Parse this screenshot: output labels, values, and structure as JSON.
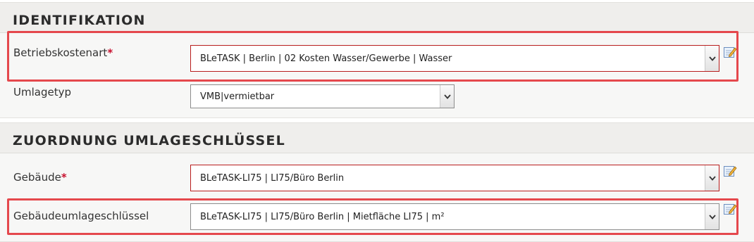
{
  "identifikation": {
    "title": "IDENTIFIKATION",
    "betriebskostenart": {
      "label": "Betriebskostenart",
      "required_mark": "*",
      "value": "BLeTASK | Berlin | 02 Kosten Wasser/Gewerbe | Wasser"
    },
    "umlagetyp": {
      "label": "Umlagetyp",
      "value": "VMB|vermietbar"
    }
  },
  "zuordnung": {
    "title": "ZUORDNUNG UMLAGESCHLÜSSEL",
    "gebaeude": {
      "label": "Gebäude",
      "required_mark": "*",
      "value": "BLeTASK-LI75 | LI75/Büro Berlin"
    },
    "gebaeudeumlageschluessel": {
      "label": "Gebäudeumlageschlüssel",
      "value": "BLeTASK-LI75 | LI75/Büro Berlin | Mietfläche LI75 | m²"
    }
  },
  "icons": {
    "dropdown": "chevron-down-icon",
    "edit": "edit-pencil-icon"
  },
  "colors": {
    "highlight": "#e5484d",
    "required": "#c8102e",
    "required_border": "#b81d1d"
  }
}
